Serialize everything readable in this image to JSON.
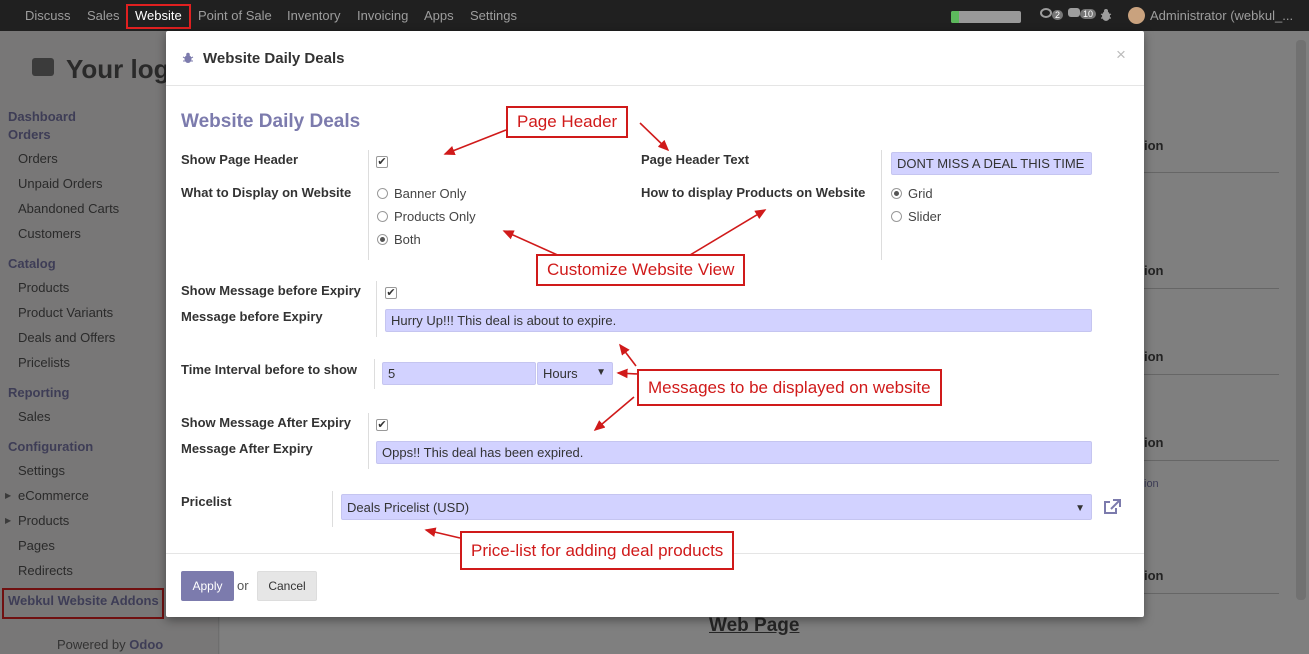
{
  "navbar": {
    "items": [
      "Discuss",
      "Sales",
      "Website",
      "Point of Sale",
      "Inventory",
      "Invoicing",
      "Apps",
      "Settings"
    ],
    "active": "Website",
    "messages_count": "2",
    "notifications_count": "10",
    "user": "Administrator (webkul_..."
  },
  "sidebar": {
    "logo_text": "Your log",
    "sections": [
      {
        "head": "Dashboard Orders"
      },
      {
        "head": "Catalog"
      },
      {
        "head": "Reporting"
      },
      {
        "head": "Configuration"
      }
    ],
    "dashboard_orders": "Dashboard",
    "dashboard_orders_2": "Orders",
    "orders_items": [
      "Orders",
      "Unpaid Orders",
      "Abandoned Carts",
      "Customers"
    ],
    "catalog_head": "Catalog",
    "catalog_items": [
      "Products",
      "Product Variants",
      "Deals and Offers",
      "Pricelists"
    ],
    "reporting_head": "Reporting",
    "reporting_items": [
      "Sales"
    ],
    "config_head": "Configuration",
    "config_items": [
      "Settings",
      "eCommerce",
      "Products",
      "Pages",
      "Redirects"
    ],
    "webkul_head": "Webkul Website Addons",
    "powered_by": "Powered by",
    "powered_brand": "Odoo"
  },
  "background": {
    "col_fragment": "ion",
    "link_fragment": "ion",
    "web_page": "Web Page"
  },
  "modal": {
    "title": "Website Daily Deals",
    "close": "×",
    "form_title": "Website Daily Deals",
    "show_page_header_label": "Show Page Header",
    "show_page_header_checked": true,
    "page_header_text_label": "Page Header Text",
    "page_header_text_value": "DONT MISS A DEAL THIS TIME",
    "display_label": "What to Display on Website",
    "display_options": [
      "Banner Only",
      "Products Only",
      "Both"
    ],
    "display_selected": "Both",
    "products_display_label": "How to display Products on Website",
    "products_display_options": [
      "Grid",
      "Slider"
    ],
    "products_display_selected": "Grid",
    "show_msg_before_label": "Show Message before Expiry",
    "msg_before_label": "Message before Expiry",
    "msg_before_value": "Hurry Up!!! This deal is about to expire.",
    "interval_label": "Time Interval before to show",
    "interval_value": "5",
    "interval_unit": "Hours",
    "show_msg_after_label": "Show Message After Expiry",
    "msg_after_label": "Message After Expiry",
    "msg_after_value": "Opps!! This deal has been expired.",
    "pricelist_label": "Pricelist",
    "pricelist_value": "Deals Pricelist (USD)",
    "apply_label": "Apply",
    "or_label": "or",
    "cancel_label": "Cancel"
  },
  "annotations": {
    "page_header": "Page Header",
    "customize_view": "Customize Website View",
    "messages": "Messages to be displayed on website",
    "pricelist": "Price-list for adding deal products"
  },
  "colors": {
    "accent": "#7c7bad",
    "annotation": "#d01a1a",
    "input_bg": "#d2d2ff",
    "navbar_bg": "#202020"
  }
}
